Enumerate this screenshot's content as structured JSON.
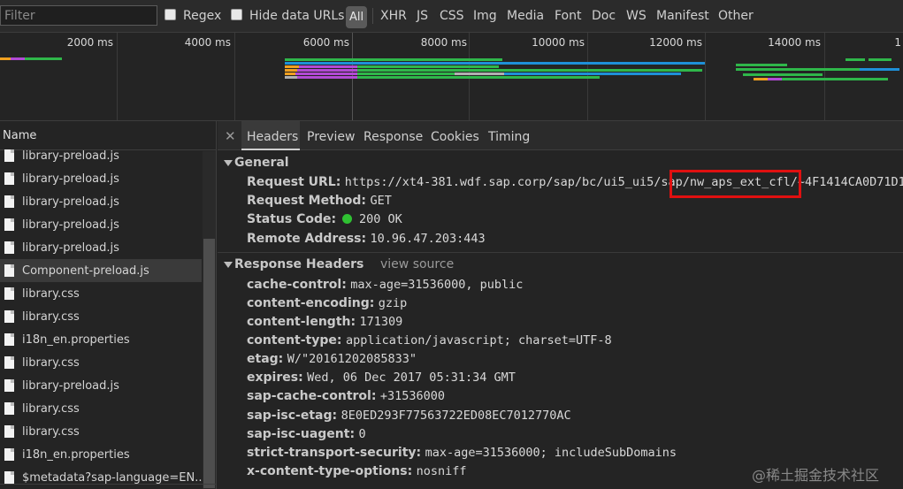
{
  "filterbar": {
    "filter_placeholder": "Filter",
    "regex_label": "Regex",
    "hide_data_urls_label": "Hide data URLs",
    "types": [
      "All",
      "XHR",
      "JS",
      "CSS",
      "Img",
      "Media",
      "Font",
      "Doc",
      "WS",
      "Manifest",
      "Other"
    ]
  },
  "overview": {
    "ticks": [
      "2000 ms",
      "4000 ms",
      "6000 ms",
      "8000 ms",
      "10000 ms",
      "12000 ms",
      "14000 ms",
      "1"
    ]
  },
  "request_list": {
    "header": "Name",
    "rows": [
      "library-preload.js",
      "library-preload.js",
      "library-preload.js",
      "library-preload.js",
      "library-preload.js",
      "Component-preload.js",
      "library.css",
      "library.css",
      "i18n_en.properties",
      "library.css",
      "library-preload.js",
      "library.css",
      "library.css",
      "i18n_en.properties",
      "$metadata?sap-language=EN..."
    ],
    "selected_index": 5
  },
  "details": {
    "close_icon": "close-icon",
    "tabs": [
      "Headers",
      "Preview",
      "Response",
      "Cookies",
      "Timing"
    ],
    "active_tab": "Headers",
    "general": {
      "title": "General",
      "request_url_key": "Request URL:",
      "request_url_value": "https://xt4-381.wdf.sap.corp/sap/bc/ui5_ui5/sap/nw_aps_ext_cfl/~4F1414CA0D71D1",
      "request_method_key": "Request Method:",
      "request_method_value": "GET",
      "status_code_key": "Status Code:",
      "status_code_value": "200 OK",
      "status_color": "#2fc132",
      "remote_address_key": "Remote Address:",
      "remote_address_value": "10.96.47.203:443"
    },
    "response_headers": {
      "title": "Response Headers",
      "view_source": "view source",
      "rows": [
        {
          "key": "cache-control:",
          "value": "max-age=31536000, public"
        },
        {
          "key": "content-encoding:",
          "value": "gzip"
        },
        {
          "key": "content-length:",
          "value": "171309"
        },
        {
          "key": "content-type:",
          "value": "application/javascript; charset=UTF-8"
        },
        {
          "key": "etag:",
          "value": "W/\"20161202085833\""
        },
        {
          "key": "expires:",
          "value": "Wed, 06 Dec 2017 05:31:34 GMT"
        },
        {
          "key": "sap-cache-control:",
          "value": "+31536000"
        },
        {
          "key": "sap-isc-etag:",
          "value": "8E0ED293F77563722ED08EC7012770AC"
        },
        {
          "key": "sap-isc-uagent:",
          "value": "0"
        },
        {
          "key": "strict-transport-security:",
          "value": "max-age=31536000; includeSubDomains"
        },
        {
          "key": "x-content-type-options:",
          "value": "nosniff"
        }
      ]
    }
  },
  "watermark": "@稀土掘金技术社区",
  "colors": {
    "highlight": "#e01010",
    "bar_green": "#2fb74a",
    "bar_blue": "#1e90d8",
    "bar_purple": "#b24ad6",
    "bar_orange": "#f0a020",
    "bar_gray": "#b0b0b0"
  }
}
